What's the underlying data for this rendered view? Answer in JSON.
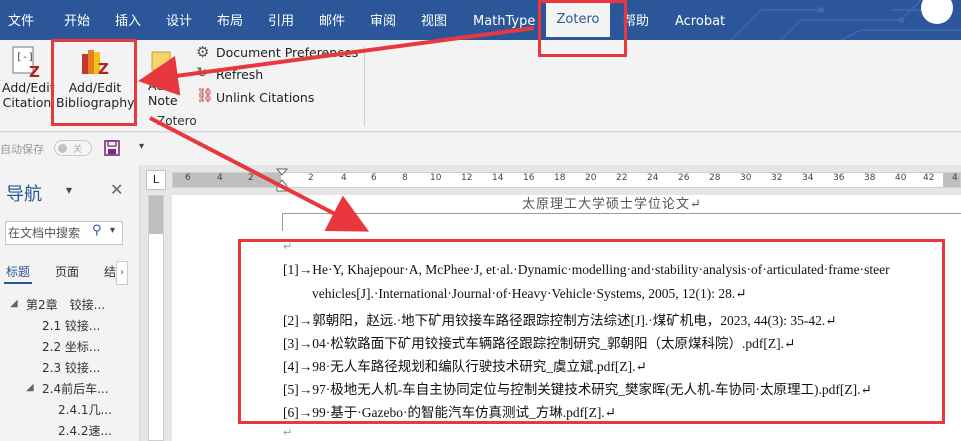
{
  "menu_tabs": [
    "文件",
    "开始",
    "插入",
    "设计",
    "布局",
    "引用",
    "邮件",
    "审阅",
    "视图",
    "MathType",
    "Zotero",
    "帮助",
    "Acrobat"
  ],
  "ribbon": {
    "add_edit_citation": "Add/Edit Citation",
    "add_edit_citation_l1": "Add/Edit",
    "add_edit_citation_l2": "Citation",
    "add_edit_bibliography_l1": "Add/Edit",
    "add_edit_bibliography_l2": "Bibliography",
    "add_note_l1": "Add",
    "add_note_l2": "Note",
    "document_preferences": "Document Preferences",
    "refresh": "Refresh",
    "unlink_citations": "Unlink Citations",
    "group_label": "Zotero"
  },
  "quick_access": {
    "autosave_label": "自动保存",
    "autosave_state": "关"
  },
  "nav": {
    "title": "导航",
    "search_placeholder": "在文档中搜索",
    "tabs": [
      "标题",
      "页面",
      "结"
    ],
    "items": [
      {
        "text": "第2章　铰接..."
      },
      {
        "text": "2.1  铰接..."
      },
      {
        "text": "2.2  坐标..."
      },
      {
        "text": "2.3  铰接..."
      },
      {
        "text": "2.4前后车..."
      },
      {
        "text": "2.4.1几..."
      },
      {
        "text": "2.4.2速..."
      }
    ]
  },
  "ruler": {
    "ticks": [
      "6",
      "4",
      "2",
      "2",
      "4",
      "6",
      "8",
      "10",
      "12",
      "14",
      "16",
      "18",
      "20",
      "22",
      "24",
      "26",
      "28",
      "30",
      "32",
      "34",
      "36",
      "38",
      "40",
      "42",
      "4"
    ],
    "corner": "L"
  },
  "document": {
    "header": "太原理工大学硕士学位论文↵",
    "paragraph_mark": "↵",
    "references": [
      "[1]→He·Y, Khajepour·A, McPhee·J, et·al.·Dynamic·modelling·and·stability·analysis·of·articulated·frame·steer",
      "vehicles[J].·International·Journal·of·Heavy·Vehicle·Systems, 2005, 12(1): 28.↵",
      "[2]→郭朝阳，赵远.·地下矿用铰接车路径跟踪控制方法综述[J].·煤矿机电，2023, 44(3): 35-42.↵",
      "[3]→04·松软路面下矿用铰接式车辆路径跟踪控制研究_郭朝阳（太原煤科院）.pdf[Z].↵",
      "[4]→98·无人车路径规划和编队行驶技术研究_虞立斌.pdf[Z].↵",
      "[5]→97·极地无人机-车自主协同定位与控制关键技术研究_樊家晖(无人机-车协同·太原理工).pdf[Z].↵",
      "[6]→99·基于·Gazebo·的智能汽车仿真测试_方琳.pdf[Z].↵"
    ]
  },
  "colors": {
    "menubar": "#2b579a",
    "annotation_red": "#e8383d",
    "ribbon_bg": "#f3f3f3"
  }
}
